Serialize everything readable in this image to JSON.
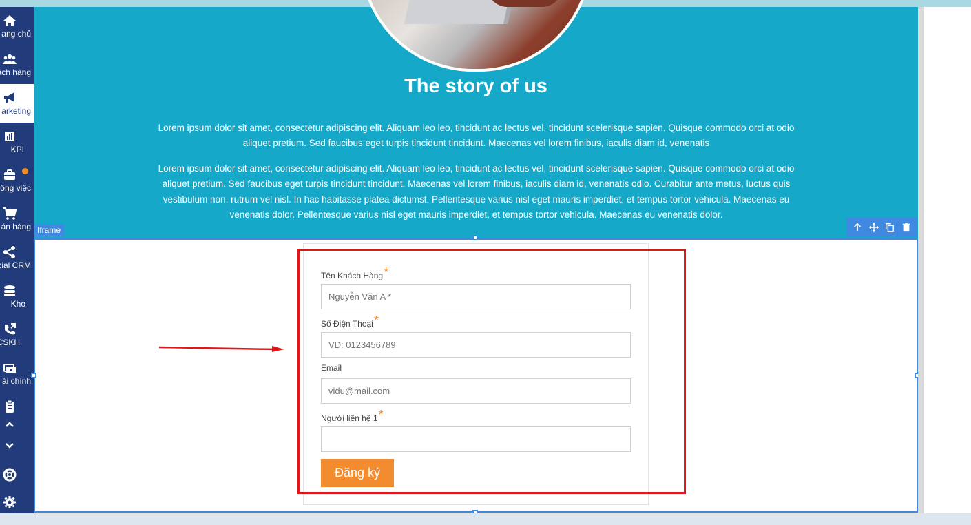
{
  "sidebar": {
    "items": [
      {
        "label": "ang chủ",
        "icon": "home-icon"
      },
      {
        "label": "ách hàng",
        "icon": "users-icon"
      },
      {
        "label": "arketing",
        "icon": "megaphone-icon"
      },
      {
        "label": "KPI",
        "icon": "chart-icon"
      },
      {
        "label": "ông việc",
        "icon": "briefcase-icon"
      },
      {
        "label": "án hàng",
        "icon": "cart-icon"
      },
      {
        "label": "cial CRM",
        "icon": "share-icon"
      },
      {
        "label": "Kho",
        "icon": "warehouse-icon"
      },
      {
        "label": "CSKH",
        "icon": "phone-icon"
      },
      {
        "label": "ài chính",
        "icon": "money-icon"
      }
    ]
  },
  "hero": {
    "title": "The story of us",
    "paragraph1": "Lorem ipsum dolor sit amet, consectetur adipiscing elit. Aliquam leo leo, tincidunt ac lectus vel, tincidunt scelerisque sapien. Quisque commodo orci at odio aliquet pretium. Sed faucibus eget turpis tincidunt tincidunt. Maecenas vel lorem finibus, iaculis diam id, venenatis",
    "paragraph2": "Lorem ipsum dolor sit amet, consectetur adipiscing elit. Aliquam leo leo, tincidunt ac lectus vel, tincidunt scelerisque sapien. Quisque commodo orci at odio aliquet pretium. Sed faucibus eget turpis tincidunt tincidunt. Maecenas vel lorem finibus, iaculis diam id, venenatis odio. Curabitur ante metus, luctus quis vestibulum non, rutrum vel nisl. In hac habitasse platea dictumst. Pellentesque varius nisl eget mauris imperdiet, et tempus tortor vehicula. Maecenas eu venenatis dolor. Pellentesque varius nisl eget mauris imperdiet, et tempus tortor vehicula. Maecenas eu venenatis dolor."
  },
  "block": {
    "tag": "Iframe"
  },
  "form": {
    "name_label": "Tên Khách Hàng",
    "name_placeholder": "Nguyễn Văn A *",
    "phone_label": "Số Điện Thoại",
    "phone_placeholder": "VD: 0123456789",
    "email_label": "Email",
    "email_placeholder": "vidu@mail.com",
    "contact_label": "Người liên hệ 1",
    "contact_value": "",
    "required_mark": "*",
    "submit_label": "Đăng ký"
  },
  "colors": {
    "hero_bg": "#16a8c9",
    "sidebar_bg": "#223b7a",
    "accent": "#f28c2f",
    "selection": "#3f8ae0",
    "highlight": "#e0161b"
  }
}
